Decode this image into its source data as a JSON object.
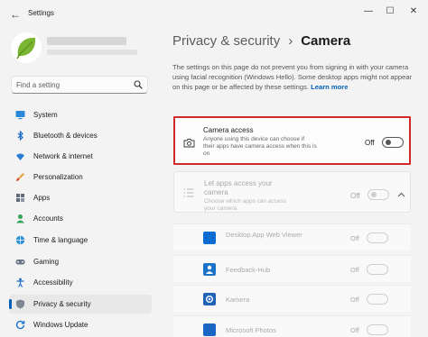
{
  "window": {
    "title": "Settings",
    "back_glyph": "←",
    "min_glyph": "—",
    "max_glyph": "☐",
    "close_glyph": "✕"
  },
  "search": {
    "placeholder": "Find a setting"
  },
  "sidebar": {
    "items": [
      {
        "label": "System",
        "icon": "monitor-icon",
        "active": false
      },
      {
        "label": "Bluetooth & devices",
        "icon": "bluetooth-icon",
        "active": false
      },
      {
        "label": "Network & internet",
        "icon": "wifi-icon",
        "active": false
      },
      {
        "label": "Personalization",
        "icon": "brush-icon",
        "active": false
      },
      {
        "label": "Apps",
        "icon": "apps-icon",
        "active": false
      },
      {
        "label": "Accounts",
        "icon": "person-icon",
        "active": false
      },
      {
        "label": "Time & language",
        "icon": "globe-icon",
        "active": false
      },
      {
        "label": "Gaming",
        "icon": "controller-icon",
        "active": false
      },
      {
        "label": "Accessibility",
        "icon": "accessibility-icon",
        "active": false
      },
      {
        "label": "Privacy & security",
        "icon": "shield-icon",
        "active": true
      },
      {
        "label": "Windows Update",
        "icon": "update-icon",
        "active": false
      }
    ]
  },
  "breadcrumb": {
    "parent": "Privacy & security",
    "separator": "›",
    "current": "Camera"
  },
  "description": {
    "text": "The settings on this page do not prevent you from signing in with your camera using facial recognition (Windows Hello). Some desktop apps might not appear on this page or be affected by these settings.",
    "link": "Learn more"
  },
  "camera_access": {
    "title": "Camera access",
    "subtitle": "Anyone using this device can choose if their apps have camera access when this is on",
    "state": "Off",
    "on": false
  },
  "apps_access": {
    "title": "Let apps access your camera",
    "subtitle": "Choose which apps can access your camera",
    "state": "Off",
    "on": false
  },
  "apps": [
    {
      "name": "Desktop App Web Viewer",
      "state": "Off",
      "color": "#0a6cd1"
    },
    {
      "name": "Feedback-Hub",
      "state": "Off",
      "color": "#1d72c9"
    },
    {
      "name": "Kamera",
      "state": "Off",
      "color": "#1f62b8"
    },
    {
      "name": "Microsoft Photos",
      "state": "Off",
      "color": "#1a66c2"
    }
  ],
  "colors": {
    "accent": "#005fb8",
    "highlight_border": "#d02a2a"
  }
}
